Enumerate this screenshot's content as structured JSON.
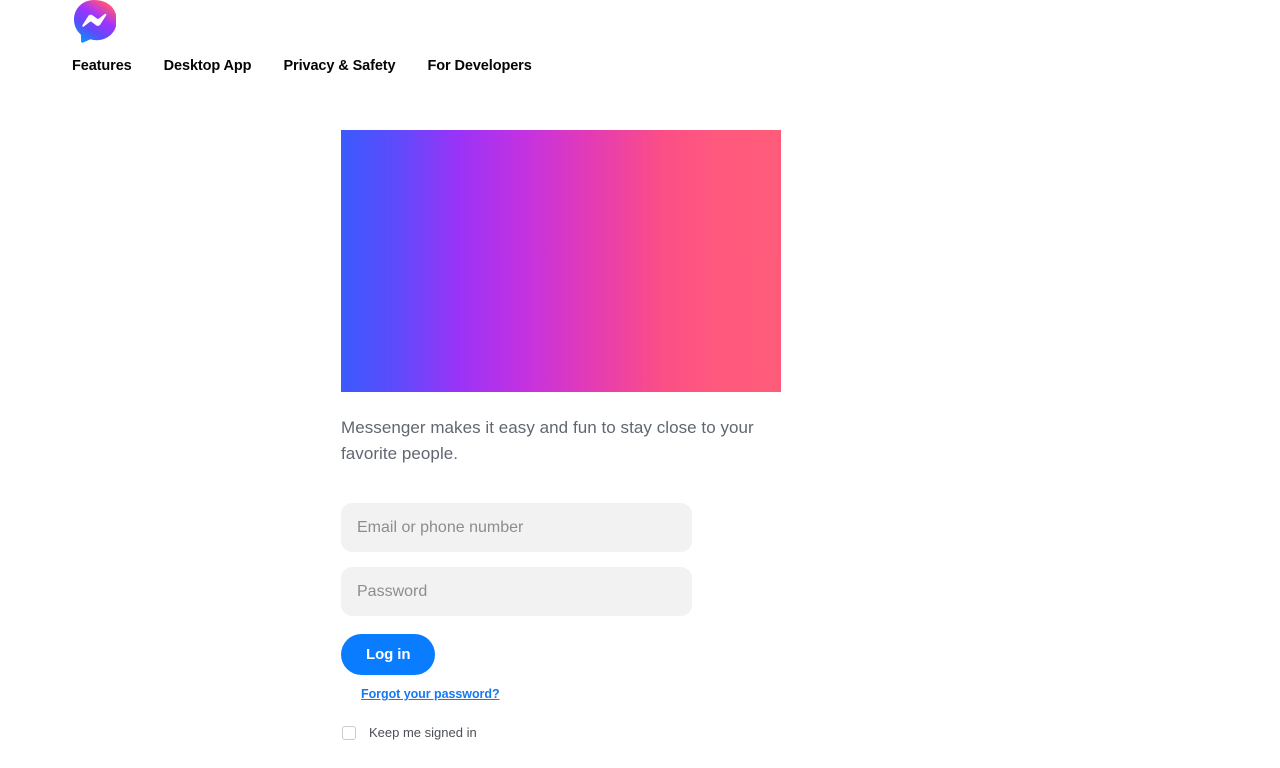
{
  "brand": {
    "logo_icon": "messenger-logo-icon",
    "name": "Messenger",
    "gradient_start": "#4b6bfb",
    "gradient_mid": "#a033ff",
    "gradient_end": "#ff5a7e"
  },
  "nav": {
    "items": [
      {
        "label": "Features"
      },
      {
        "label": "Desktop App"
      },
      {
        "label": "Privacy & Safety"
      },
      {
        "label": "For Developers"
      }
    ]
  },
  "hero": {
    "alt": "messenger-gradient-banner",
    "gradient_from": "#3b5afe",
    "gradient_via": "#b632e8",
    "gradient_to": "#ff5b79"
  },
  "content": {
    "tagline": "Messenger makes it easy and fun to stay close to your favorite people."
  },
  "login": {
    "email_placeholder": "Email or phone number",
    "email_value": "",
    "password_placeholder": "Password",
    "password_value": "",
    "submit_label": "Log in",
    "submit_color": "#0a7cff",
    "forgot_label": "Forgot your password?",
    "forgot_color": "#1877f2",
    "keep_signed_in_label": "Keep me signed in",
    "keep_signed_in_checked": false
  }
}
